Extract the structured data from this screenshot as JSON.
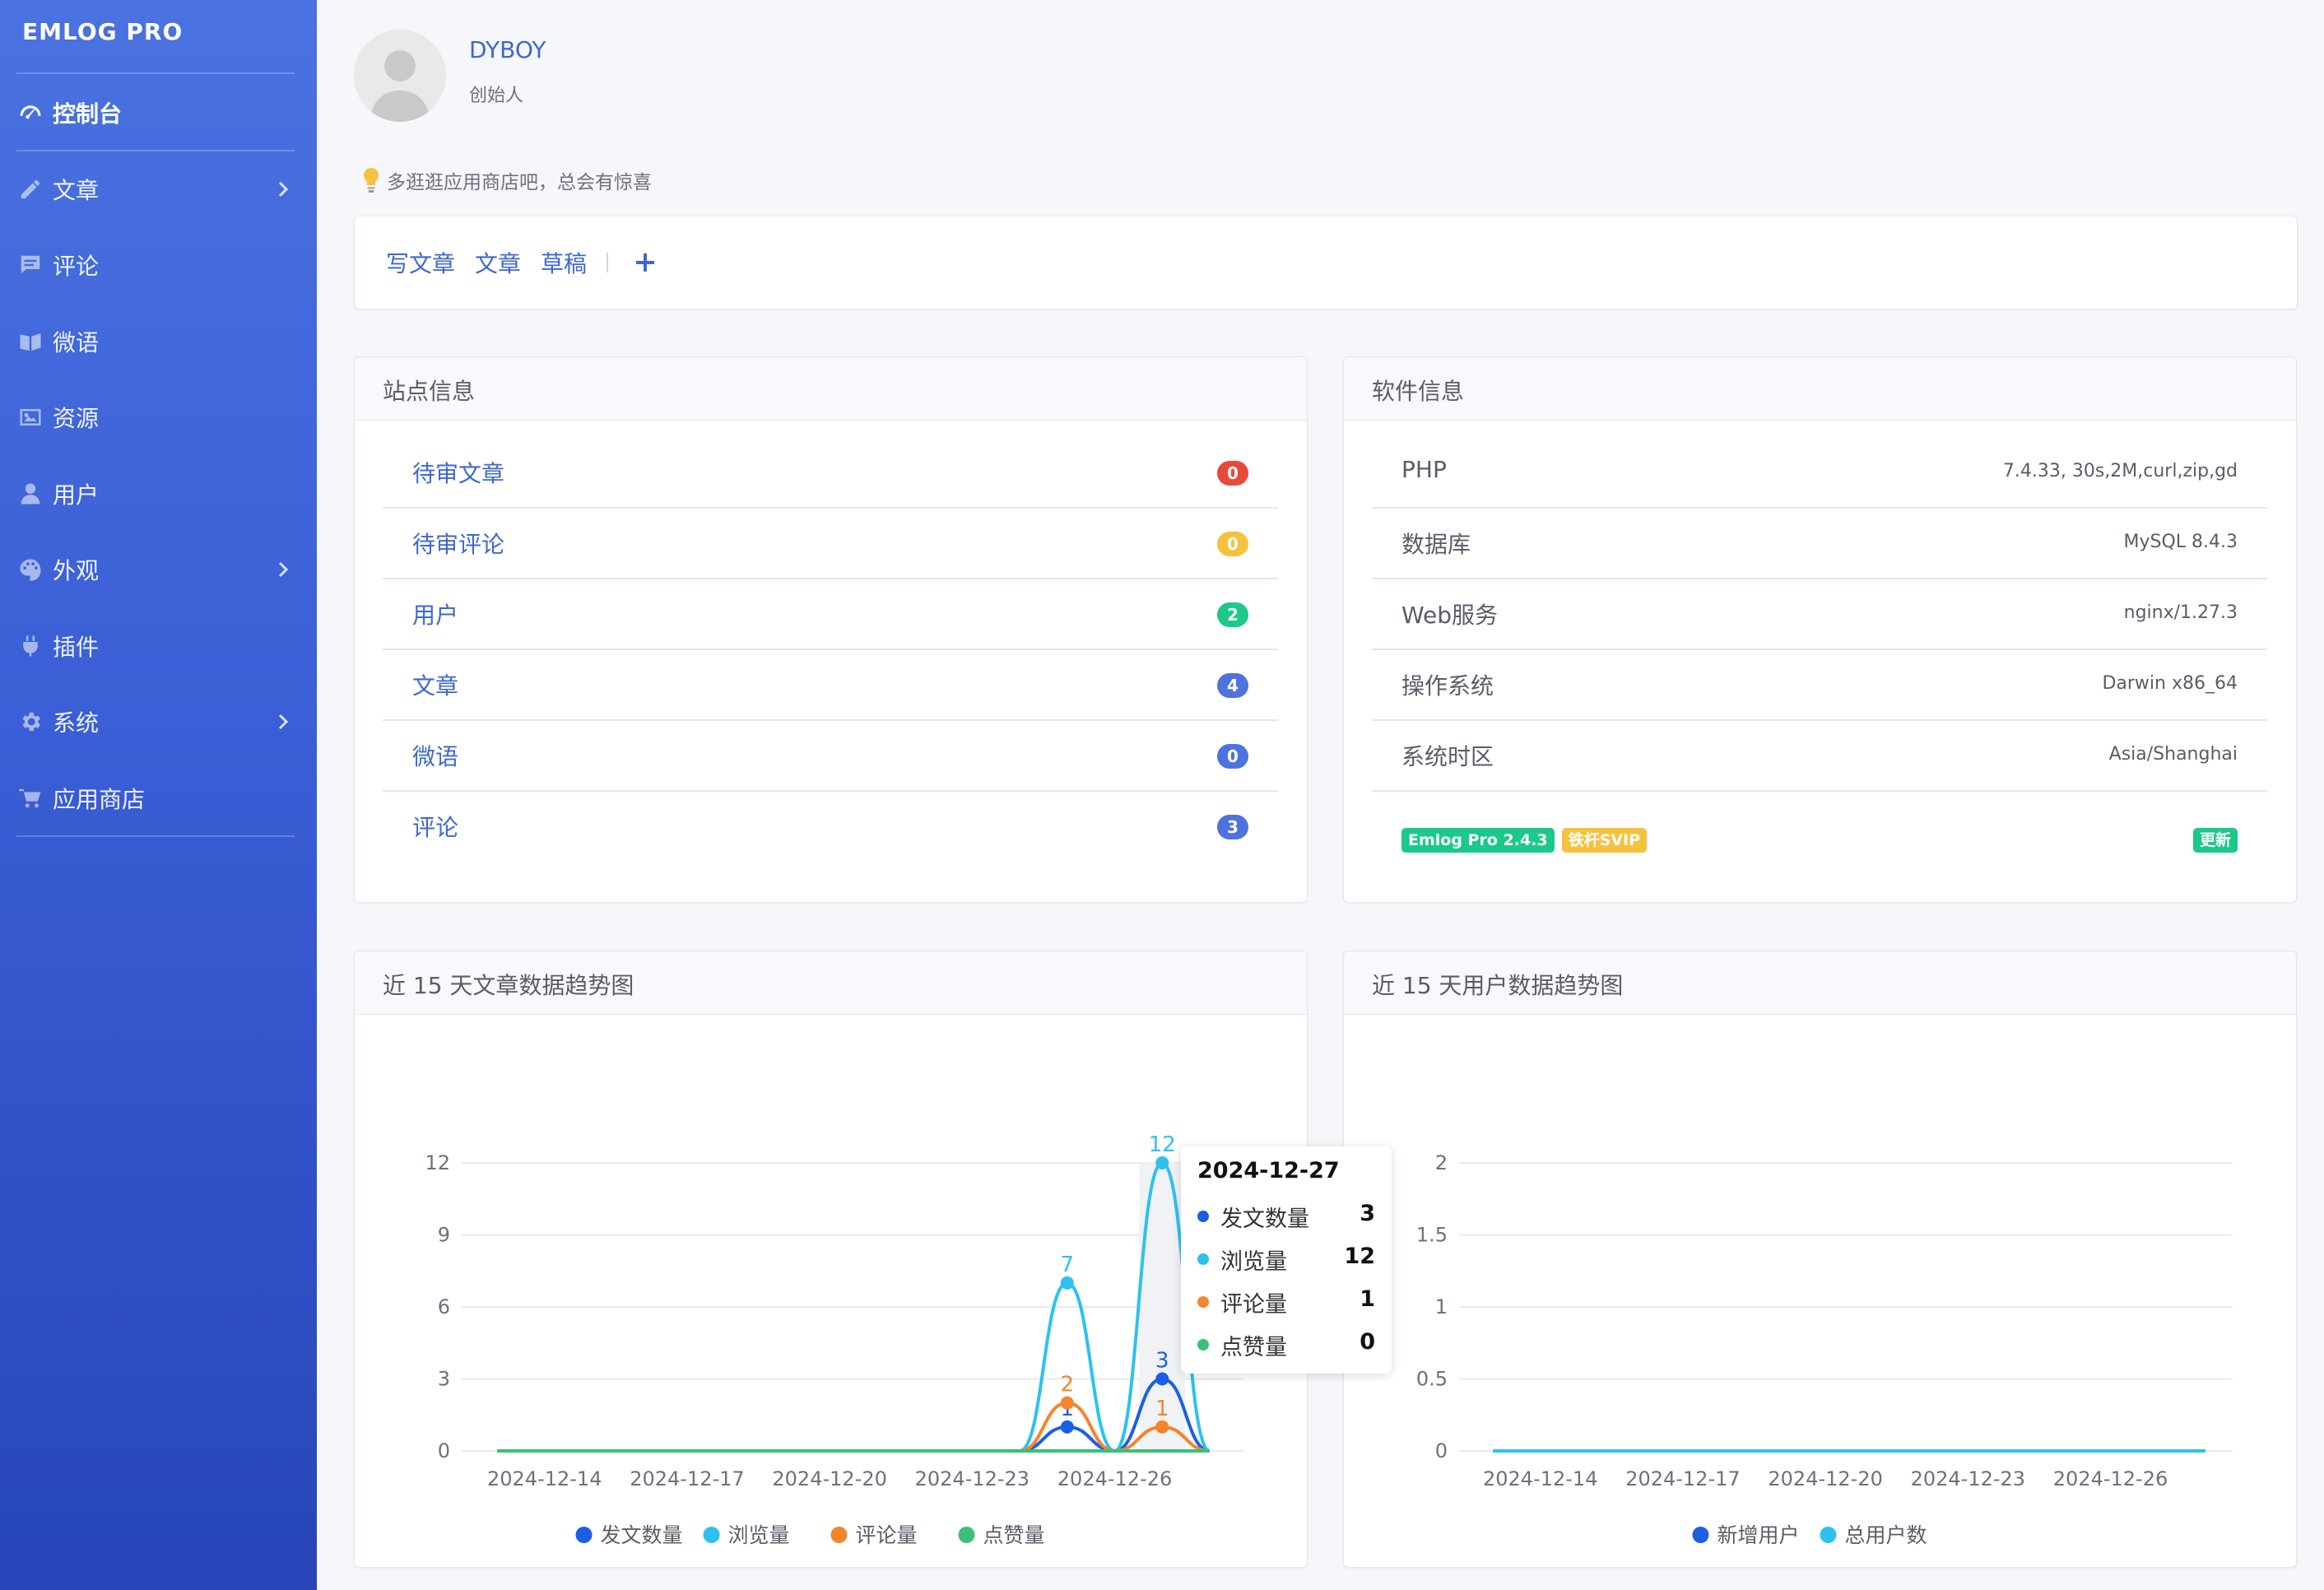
{
  "sidebar": {
    "brand": "EMLOG PRO",
    "items": [
      {
        "label": "控制台",
        "icon": "dashboard-icon",
        "active": true,
        "chevron": false
      },
      {
        "label": "文章",
        "icon": "pencil-icon",
        "chevron": true
      },
      {
        "label": "评论",
        "icon": "comment-icon",
        "chevron": false
      },
      {
        "label": "微语",
        "icon": "notes-icon",
        "chevron": false
      },
      {
        "label": "资源",
        "icon": "image-icon",
        "chevron": false
      },
      {
        "label": "用户",
        "icon": "user-icon",
        "chevron": false
      },
      {
        "label": "外观",
        "icon": "palette-icon",
        "chevron": true
      },
      {
        "label": "插件",
        "icon": "plug-icon",
        "chevron": false
      },
      {
        "label": "系统",
        "icon": "gear-icon",
        "chevron": true
      },
      {
        "label": "应用商店",
        "icon": "cart-icon",
        "chevron": false
      }
    ]
  },
  "profile": {
    "name": "DYBOY",
    "role": "创始人"
  },
  "tip": "多逛逛应用商店吧，总会有惊喜",
  "quick": {
    "links": [
      "写文章",
      "文章",
      "草稿"
    ],
    "plus_icon": "plus-icon"
  },
  "site_info": {
    "title": "站点信息",
    "rows": [
      {
        "label": "待审文章",
        "count": "0",
        "color": "#e74a3b"
      },
      {
        "label": "待审评论",
        "count": "0",
        "color": "#f6c23e"
      },
      {
        "label": "用户",
        "count": "2",
        "color": "#1cc88a"
      },
      {
        "label": "文章",
        "count": "4",
        "color": "#4e73df"
      },
      {
        "label": "微语",
        "count": "0",
        "color": "#4e73df"
      },
      {
        "label": "评论",
        "count": "3",
        "color": "#4e73df"
      }
    ]
  },
  "software_info": {
    "title": "软件信息",
    "rows": [
      {
        "label": "PHP",
        "value": "7.4.33, 30s,2M,curl,zip,gd"
      },
      {
        "label": "数据库",
        "value": "MySQL 8.4.3"
      },
      {
        "label": "Web服务",
        "value": "nginx/1.27.3"
      },
      {
        "label": "操作系统",
        "value": "Darwin x86_64"
      },
      {
        "label": "系统时区",
        "value": "Asia/Shanghai"
      }
    ],
    "version_tag": "Emlog Pro 2.4.3",
    "version_color": "#1cc88a",
    "svip_tag": "铁杆SVIP",
    "svip_color": "#f6c23e",
    "update_label": "更新"
  },
  "chart_data": [
    {
      "type": "line",
      "title": "近 15 天文章数据趋势图",
      "x": [
        "2024-12-13",
        "2024-12-14",
        "2024-12-15",
        "2024-12-16",
        "2024-12-17",
        "2024-12-18",
        "2024-12-19",
        "2024-12-20",
        "2024-12-21",
        "2024-12-22",
        "2024-12-23",
        "2024-12-24",
        "2024-12-25",
        "2024-12-26",
        "2024-12-27",
        "2024-12-28"
      ],
      "x_ticks": [
        "2024-12-14",
        "2024-12-17",
        "2024-12-20",
        "2024-12-23",
        "2024-12-26"
      ],
      "y_ticks": [
        "0",
        "3",
        "6",
        "9",
        "12"
      ],
      "ylim": [
        0,
        12
      ],
      "series": [
        {
          "name": "发文数量",
          "color": "#1a5fe6",
          "values": [
            0,
            0,
            0,
            0,
            0,
            0,
            0,
            0,
            0,
            0,
            0,
            0,
            1,
            0,
            3,
            0
          ]
        },
        {
          "name": "浏览量",
          "color": "#2ec1f0",
          "values": [
            0,
            0,
            0,
            0,
            0,
            0,
            0,
            0,
            0,
            0,
            0,
            0,
            7,
            0,
            12,
            0
          ]
        },
        {
          "name": "评论量",
          "color": "#f5842b",
          "values": [
            0,
            0,
            0,
            0,
            0,
            0,
            0,
            0,
            0,
            0,
            0,
            0,
            2,
            0,
            1,
            0
          ]
        },
        {
          "name": "点赞量",
          "color": "#3bbf7a",
          "values": [
            0,
            0,
            0,
            0,
            0,
            0,
            0,
            0,
            0,
            0,
            0,
            0,
            0,
            0,
            0,
            0
          ]
        }
      ],
      "tooltip": {
        "date": "2024-12-27",
        "rows": [
          {
            "name": "发文数量",
            "value": "3"
          },
          {
            "name": "浏览量",
            "value": "12"
          },
          {
            "name": "评论量",
            "value": "1"
          },
          {
            "name": "点赞量",
            "value": "0"
          }
        ]
      }
    },
    {
      "type": "line",
      "title": "近 15 天用户数据趋势图",
      "x": [
        "2024-12-13",
        "2024-12-14",
        "2024-12-15",
        "2024-12-16",
        "2024-12-17",
        "2024-12-18",
        "2024-12-19",
        "2024-12-20",
        "2024-12-21",
        "2024-12-22",
        "2024-12-23",
        "2024-12-24",
        "2024-12-25",
        "2024-12-26",
        "2024-12-27",
        "2024-12-28"
      ],
      "x_ticks": [
        "2024-12-14",
        "2024-12-17",
        "2024-12-20",
        "2024-12-23",
        "2024-12-26"
      ],
      "y_ticks": [
        "0",
        "0.5",
        "1",
        "1.5",
        "2"
      ],
      "ylim": [
        0,
        2
      ],
      "series": [
        {
          "name": "新增用户",
          "color": "#1a5fe6",
          "values": [
            0,
            0,
            0,
            0,
            0,
            0,
            0,
            0,
            0,
            0,
            0,
            0,
            0,
            0,
            0,
            0
          ]
        },
        {
          "name": "总用户数",
          "color": "#2ec1f0",
          "values": [
            0,
            0,
            0,
            0,
            0,
            0,
            0,
            0,
            0,
            0,
            0,
            0,
            0,
            0,
            0,
            0
          ]
        }
      ]
    }
  ]
}
